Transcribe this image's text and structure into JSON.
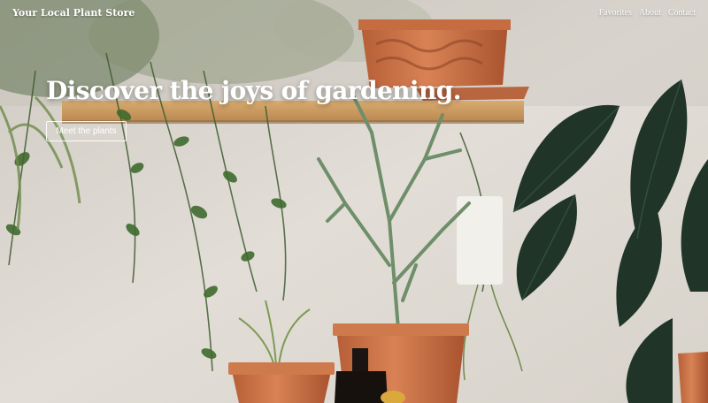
{
  "header": {
    "brand": "Your Local Plant Store",
    "nav": [
      {
        "label": "Favorites"
      },
      {
        "label": "About"
      },
      {
        "label": "Contact"
      }
    ]
  },
  "hero": {
    "headline": "Discover the joys of gardening.",
    "cta_label": "Meet the plants"
  },
  "colors": {
    "wall": "#dcd8d1",
    "shelf": "#c99b61",
    "terracotta": "#c96f42",
    "leaf_dark": "#24382b",
    "leaf_green": "#4f7a3c",
    "text": "#ffffff"
  }
}
